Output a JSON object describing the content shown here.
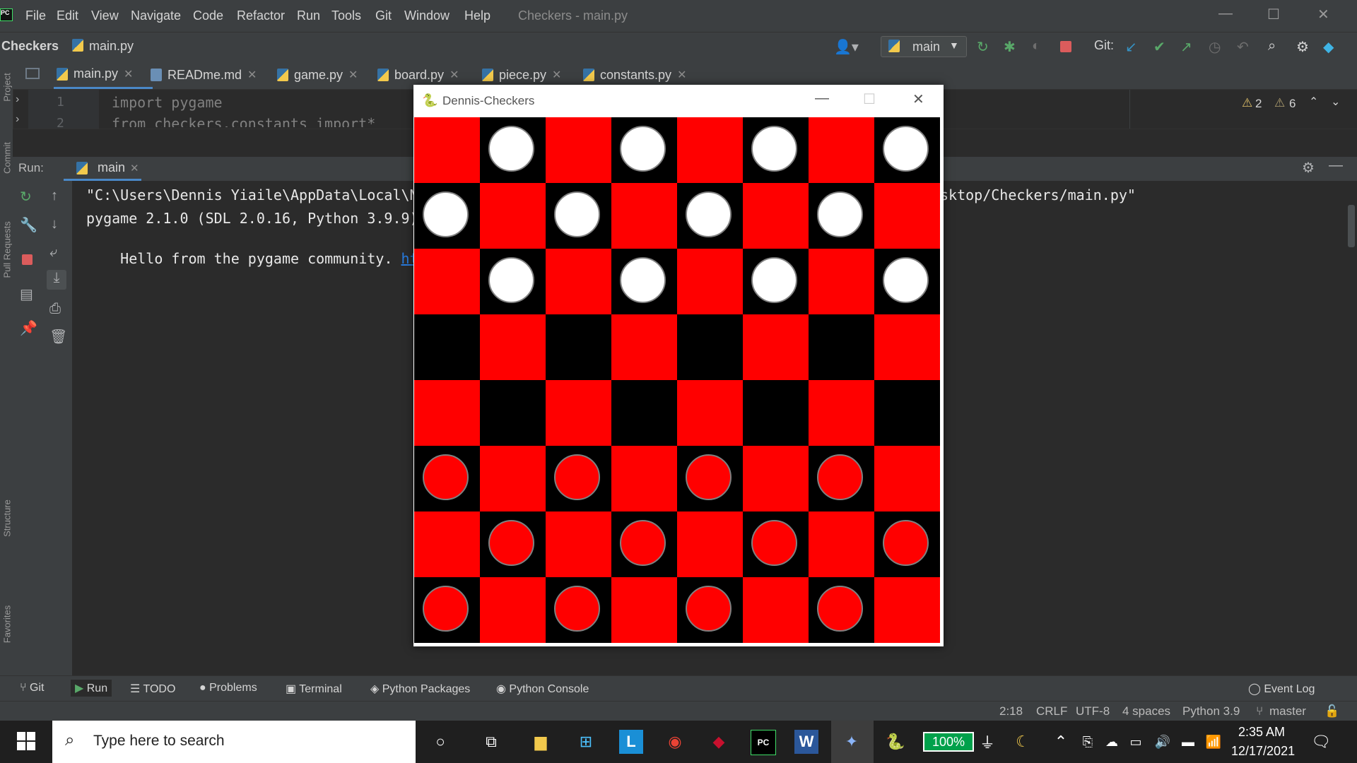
{
  "menubar": {
    "logo": "PC",
    "items": [
      "File",
      "Edit",
      "View",
      "Navigate",
      "Code",
      "Refactor",
      "Run",
      "Tools",
      "Git",
      "Window",
      "Help"
    ],
    "window_title": "Checkers - main.py",
    "controls": [
      "—",
      "☐",
      "✕"
    ]
  },
  "navbar": {
    "project": "Checkers",
    "file": "main.py",
    "run_config": "main",
    "git_label": "Git:"
  },
  "left_stripe": [
    "Project",
    "Commit",
    "Pull Requests",
    "Structure",
    "Favorites"
  ],
  "tabs": [
    {
      "label": "main.py",
      "icon": "python-file-icon",
      "active": true
    },
    {
      "label": "READme.md",
      "icon": "markdown-file-icon",
      "active": false
    },
    {
      "label": "game.py",
      "icon": "python-file-icon",
      "active": false
    },
    {
      "label": "board.py",
      "icon": "python-file-icon",
      "active": false
    },
    {
      "label": "piece.py",
      "icon": "python-file-icon",
      "active": false
    },
    {
      "label": "constants.py",
      "icon": "python-file-icon",
      "active": false
    }
  ],
  "editor": {
    "lines": [
      {
        "num": "1",
        "code": "import pygame"
      },
      {
        "num": "2",
        "code": "from checkers.constants import*"
      }
    ],
    "warnings": "2",
    "weak_warnings": "6"
  },
  "run_panel": {
    "label": "Run:",
    "tab": "main",
    "console": [
      {
        "text": "\"C:\\Users\\Dennis Yiaile\\AppData\\Local\\N"
      },
      {
        "text": "pygame 2.1.0 (SDL 2.0.16, Python 3.9.9)"
      },
      {
        "text": "Hello from the pygame community. ",
        "link": "https:"
      }
    ],
    "console_tail": "sktop/Checkers/main.py\""
  },
  "game_window": {
    "title": "Dennis-Checkers",
    "board": {
      "rows": 8,
      "cols": 8,
      "light_color": "#ff0000",
      "dark_color": "#000000",
      "white_piece_color": "#ffffff",
      "red_piece_color": "#ff0000",
      "pieces": [
        ".W.W.W.W",
        "W.W.W.W.",
        ".W.W.W.W",
        "........",
        "........",
        "R.R.R.R.",
        ".R.R.R.R",
        "R.R.R.R."
      ]
    }
  },
  "bottom_tools": [
    "Git",
    "Run",
    "TODO",
    "Problems",
    "Terminal",
    "Python Packages",
    "Python Console",
    "Event Log"
  ],
  "statusbar": {
    "position": "2:18",
    "line_sep": "CRLF",
    "encoding": "UTF-8",
    "indent": "4 spaces",
    "interpreter": "Python 3.9",
    "branch": "master"
  },
  "taskbar": {
    "search_placeholder": "Type here to search",
    "battery": "100%",
    "time": "2:35 AM",
    "date": "12/17/2021"
  }
}
